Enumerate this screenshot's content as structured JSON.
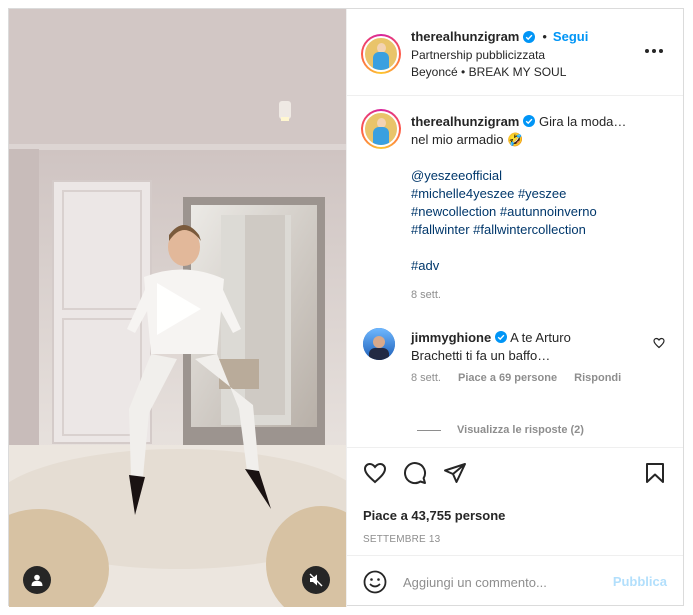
{
  "post": {
    "username": "therealhunzigram",
    "follow_label": "Segui",
    "separator": "•",
    "partnership": "Partnership pubblicizzata",
    "audio": "Beyoncé • BREAK MY SOUL"
  },
  "caption": {
    "username": "therealhunzigram",
    "text": "Gira la moda… nel mio armadio 🤣",
    "mention": "@yeszeeofficial",
    "hashtags_line1": "#michelle4yeszee #yeszee",
    "hashtags_line2": "#newcollection #autunnoinverno",
    "hashtags_line3": "#fallwinter #fallwintercollection",
    "hashtag_adv": "#adv",
    "time": "8 sett."
  },
  "comment": {
    "username": "jimmyghione",
    "text": "A te Arturo Brachetti ti fa un baffo…",
    "time": "8 sett.",
    "likes": "Piace a 69 persone",
    "reply": "Rispondi",
    "view_replies": "Visualizza le risposte (2)"
  },
  "actions": {
    "likes_count": "Piace a 43,755 persone",
    "date": "SETTEMBRE 13"
  },
  "composer": {
    "placeholder": "Aggiungi un commento...",
    "publish": "Pubblica"
  },
  "icons": {
    "like": "heart-icon",
    "comment": "comment-icon",
    "share": "share-icon",
    "save": "bookmark-icon",
    "emoji": "emoji-icon",
    "mute": "speaker-muted-icon",
    "user": "user-tag-icon",
    "play": "play-icon"
  },
  "colors": {
    "link": "#00376b",
    "follow": "#0095f6",
    "publish_disabled": "#b2dffc",
    "verified": "#0095f6"
  }
}
